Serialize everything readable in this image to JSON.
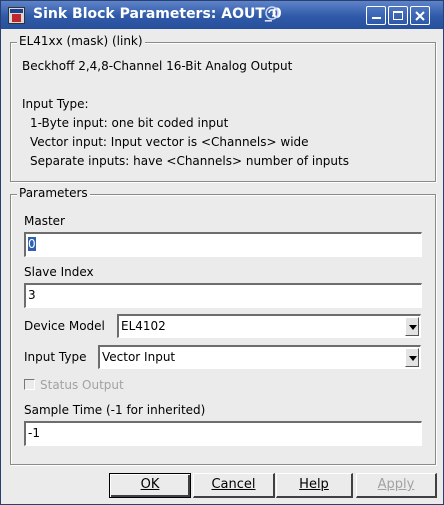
{
  "window": {
    "title": "Sink Block Parameters: AOUT_0",
    "controls": {
      "minimize": "minimize",
      "maximize": "maximize",
      "close": "close"
    }
  },
  "mask": {
    "legend": "EL41xx (mask) (link)",
    "description": "Beckhoff 2,4,8-Channel 16-Bit Analog Output",
    "input_type_heading": "Input Type:",
    "input_type_lines": [
      "1-Byte input: one bit coded input",
      "Vector input: Input vector is <Channels> wide",
      "Separate inputs: have <Channels> number of inputs"
    ]
  },
  "parameters": {
    "legend": "Parameters",
    "master": {
      "label": "Master",
      "value": "0"
    },
    "slave_index": {
      "label": "Slave Index",
      "value": "3"
    },
    "device_model": {
      "label": "Device Model",
      "value": "EL4102"
    },
    "input_type": {
      "label": "Input Type",
      "value": "Vector Input"
    },
    "status_output": {
      "label": "Status Output",
      "checked": false,
      "enabled": false
    },
    "sample_time": {
      "label": "Sample Time (-1 for inherited)",
      "value": "-1"
    }
  },
  "buttons": {
    "ok": "OK",
    "cancel": "Cancel",
    "help": "Help",
    "apply": "Apply"
  },
  "colors": {
    "titlebar": "#2f5aa8",
    "selection": "#2e5fb0",
    "window_bg": "#ebebeb"
  }
}
